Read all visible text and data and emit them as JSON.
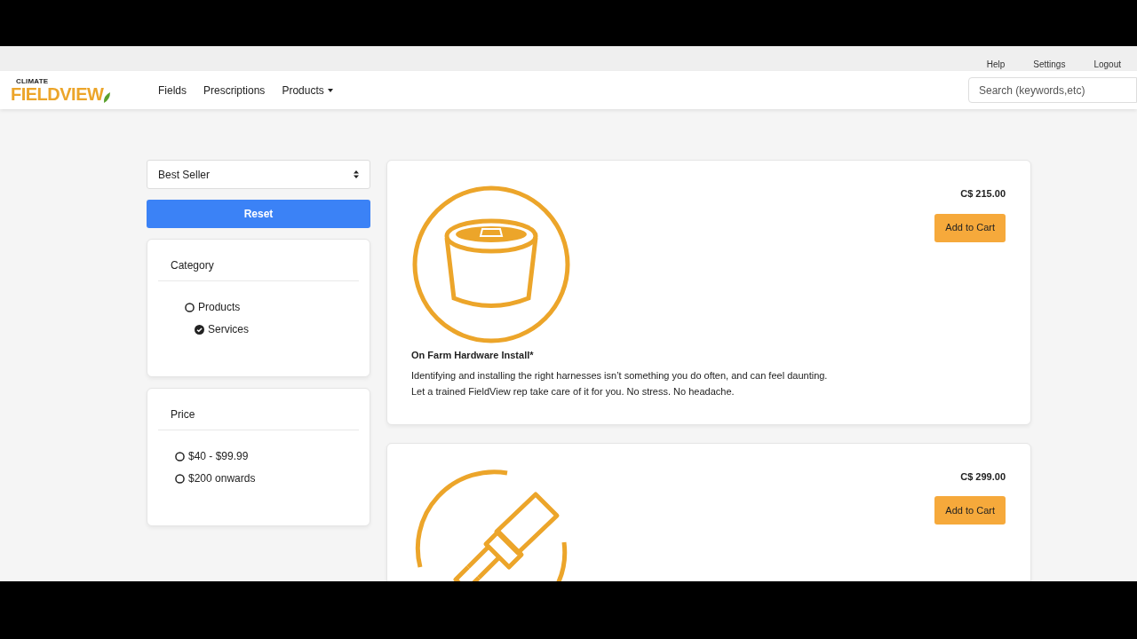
{
  "top_links": [
    "Help",
    "Settings",
    "Logout"
  ],
  "logo": {
    "small": "CLIMATE",
    "big": "FIELDVIEW"
  },
  "nav": [
    {
      "label": "Fields",
      "dropdown": false
    },
    {
      "label": "Prescriptions",
      "dropdown": false
    },
    {
      "label": "Products",
      "dropdown": true
    }
  ],
  "search": {
    "placeholder": "Search (keywords,etc)"
  },
  "sort": {
    "value": "Best Seller"
  },
  "reset_button": "Reset",
  "filters": [
    {
      "title": "Category",
      "indented": true,
      "options": [
        {
          "label": "Products",
          "selected": false,
          "children": [
            {
              "label": "Services",
              "selected": true
            }
          ]
        }
      ]
    },
    {
      "title": "Price",
      "indented": false,
      "options": [
        {
          "label": "$40 - $99.99",
          "selected": false
        },
        {
          "label": "$200 onwards",
          "selected": false
        }
      ]
    }
  ],
  "products": [
    {
      "kind": "bucket",
      "price": "C$ 215.00",
      "button": "Add to Cart",
      "title": "On Farm Hardware Install*",
      "description": [
        "Identifying and installing the right harnesses isn’t something you do often, and can feel daunting.",
        "Let a trained FieldView rep take care of it for you. No stress. No headache."
      ]
    },
    {
      "kind": "connector",
      "price": "C$ 299.00",
      "button": "Add to Cart"
    }
  ]
}
